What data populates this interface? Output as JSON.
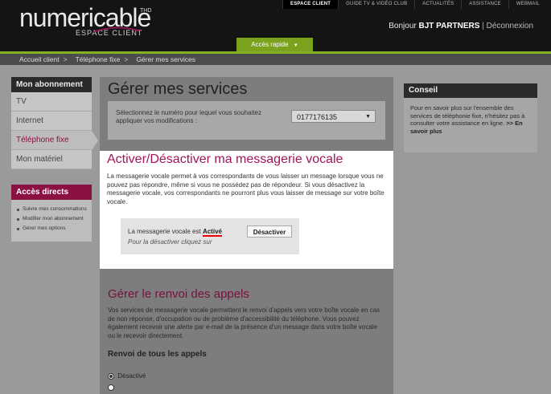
{
  "header": {
    "brand": "numericable",
    "brand_sup": "THD",
    "brand_sub": "ESPACE CLIENT",
    "topnav": [
      "ESPACE CLIENT",
      "GUIDE TV & VIDÉO CLUB",
      "ACTUALITÉS",
      "ASSISTANCE",
      "WEBMAIL"
    ],
    "greeting": "Bonjour",
    "user": "BJT PARTNERS",
    "separator": "|",
    "logout": "Déconnexion",
    "quick_access": "Accès rapide",
    "quick_arrow": "▼"
  },
  "breadcrumb": [
    "Accueil client",
    "Téléphone fixe",
    "Gérer mes services"
  ],
  "breadcrumb_sep": ">",
  "sidebar": {
    "title": "Mon abonnement",
    "items": [
      "TV",
      "Internet",
      "Téléphone fixe",
      "Mon matériel"
    ],
    "active_index": 2,
    "direct_title": "Accès directs",
    "direct_links": [
      "Suivre mes consommations",
      "Modifier mon abonnement",
      "Gérer mes options"
    ]
  },
  "main": {
    "title": "Gérer mes services",
    "select_prompt": "Sélectionnez le numéro pour lequel vous souhaitez appliquer vos modifications :",
    "selected_number": "0177176135",
    "voicemail": {
      "title": "Activer/Désactiver ma messagerie vocale",
      "description": "La messagerie vocale permet à vos correspondants de vous laisser un message lorsque vous ne pouvez pas répondre, même si vous ne possédez pas de répondeur. Si vous désactivez la messagerie vocale, vos correspondants ne pourront plus vous laisser de message sur votre boîte vocale.",
      "status_label": "La messagerie vocale est",
      "status_value": "Activé",
      "hint": "Pour la désactiver cliquez sur",
      "button": "Désactiver"
    },
    "forwarding": {
      "title": "Gérer le renvoi des appels",
      "description": "Vos services de messagerie vocale permettent le renvoi d'appels vers votre boîte vocale en cas de non réponse, d'occupation ou de problème d'accessibilité du téléphone. Vous pouvez également recevoir une alerte par e-mail de la présence d'un message dans votre boîte vocale ou le recevoir directement.",
      "subtitle": "Renvoi de tous les appels",
      "option_disabled": "Désactivé"
    }
  },
  "conseil": {
    "title": "Conseil",
    "text": "Pour en savoir plus sur l'ensemble des services de téléphonie fixe, n'hésitez pas à consulter votre assistance en ligne.",
    "more": ">> En savoir plus"
  },
  "colors": {
    "accent": "#a3145a",
    "green": "#7ba21c",
    "header": "#141414"
  }
}
